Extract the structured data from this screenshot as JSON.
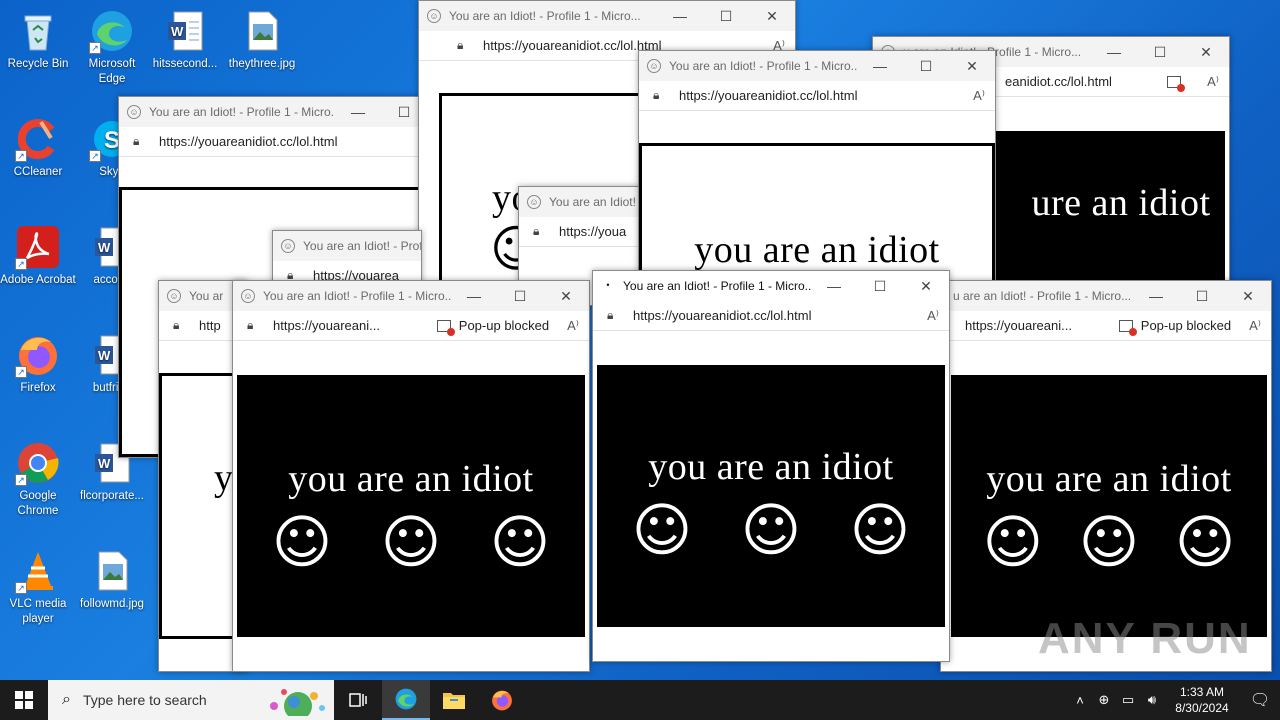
{
  "desktop": {
    "icons": [
      {
        "label": "Recycle Bin",
        "icon": "recycle-bin-icon"
      },
      {
        "label": "Microsoft Edge",
        "icon": "edge-icon"
      },
      {
        "label": "hitssecond...",
        "icon": "word-doc-icon"
      },
      {
        "label": "theythree.jpg",
        "icon": "image-file-icon"
      },
      {
        "label": "CCleaner",
        "icon": "ccleaner-icon"
      },
      {
        "label": "Skyp",
        "icon": "skype-icon"
      },
      {
        "label": "Adobe Acrobat",
        "icon": "acrobat-icon"
      },
      {
        "label": "accoun",
        "icon": "word-doc-icon"
      },
      {
        "label": "Firefox",
        "icon": "firefox-icon"
      },
      {
        "label": "butfrien",
        "icon": "word-doc-icon"
      },
      {
        "label": "Google Chrome",
        "icon": "chrome-icon"
      },
      {
        "label": "flcorporate...",
        "icon": "word-doc-icon"
      },
      {
        "label": "VLC media player",
        "icon": "vlc-icon"
      },
      {
        "label": "followmd.jpg",
        "icon": "image-file-icon"
      }
    ]
  },
  "window": {
    "title": "You are an Idiot! - Profile 1 - Micro...",
    "title_short": "You are an Idiot! - Profi",
    "title_a": "You are an Idiot! - Profile 1 - Micro...",
    "url": "https://youareanidiot.cc/lol.html",
    "url_short": "https://youareani...",
    "url_cut_1": "https://youa",
    "url_cut_2": "https://youarea",
    "url_cut_3": "http",
    "title_cut_1": "You are an Idiot! -",
    "title_cut_2": "You ar",
    "popup_label": "Pop-up blocked",
    "message": "you are an idiot",
    "message_cut_1": "yo",
    "message_cut_2": "y",
    "partial_title": "You are an Idiot! - Profile 1 - Micro...",
    "partial_title_right": "u are an Idiot! - Profile 1 - Micro...",
    "message_right": "ure an idiot",
    "url_right": "eanidiot.cc/lol.html"
  },
  "taskbar": {
    "search_placeholder": "Type here to search",
    "time": "1:33 AM",
    "date": "8/30/2024"
  },
  "watermark": "ANY RUN",
  "colors": {
    "desktop": "#0b63c9",
    "taskbar": "#1c1c1c",
    "accent": "#76b9ed"
  }
}
